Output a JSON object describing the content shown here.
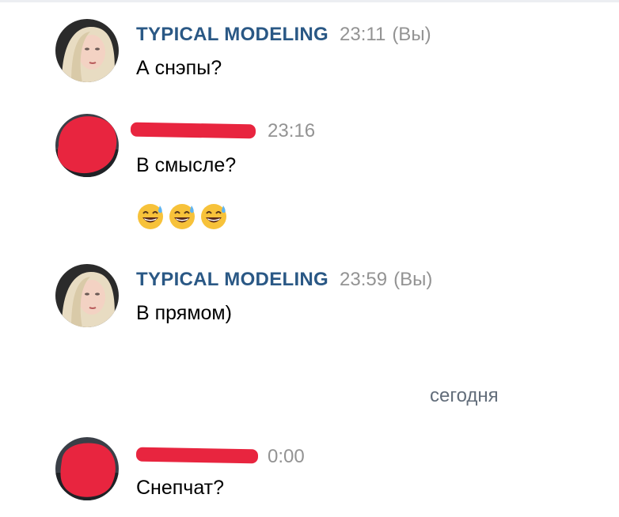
{
  "messages": [
    {
      "author": "TYPICAL MODELING",
      "time": "23:11",
      "you": "(Вы)",
      "lines": [
        "А снэпы?"
      ]
    },
    {
      "author": "",
      "time": "23:16",
      "lines": [
        "В смысле?"
      ],
      "emojis": [
        "sweat-smile-emoji",
        "sweat-smile-emoji",
        "sweat-smile-emoji"
      ]
    },
    {
      "author": "TYPICAL MODELING",
      "time": "23:59",
      "you": "(Вы)",
      "lines": [
        "В прямом)"
      ]
    },
    {
      "author": "",
      "time": "0:00",
      "lines": [
        "Снепчат?"
      ]
    }
  ],
  "date_separator": "сегодня",
  "colors": {
    "author": "#2a5885",
    "time": "#939393",
    "redaction": "#e8253f",
    "date_separator": "#626d7a"
  }
}
